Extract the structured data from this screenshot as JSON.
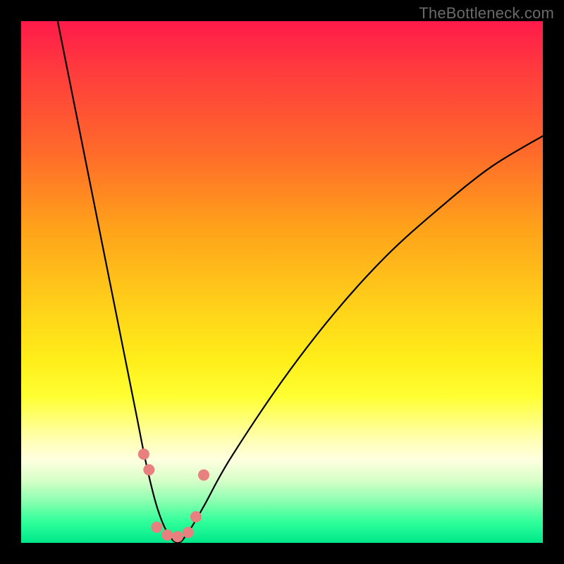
{
  "watermark": "TheBottleneck.com",
  "chart_data": {
    "type": "line",
    "title": "",
    "xlabel": "",
    "ylabel": "",
    "xlim": [
      0,
      100
    ],
    "ylim": [
      0,
      100
    ],
    "grid": false,
    "legend": false,
    "background_gradient": {
      "top": "#ff1a4a",
      "mid": "#ffee1a",
      "bottom": "#00e88a"
    },
    "series": [
      {
        "name": "bottleneck-curve",
        "type": "line",
        "x": [
          7,
          10,
          13,
          16,
          19,
          22,
          24,
          26,
          28,
          30,
          32,
          35,
          40,
          50,
          60,
          70,
          80,
          90,
          100
        ],
        "y": [
          100,
          85,
          70,
          55,
          40,
          25,
          15,
          7,
          2,
          0,
          2,
          7,
          16,
          31,
          44,
          55,
          64,
          72,
          78
        ]
      }
    ],
    "markers": {
      "name": "highlighted-points",
      "color": "#e98080",
      "x": [
        23.5,
        24.5,
        26,
        28,
        30,
        32,
        33.5,
        35
      ],
      "y": [
        17,
        14,
        3,
        1.5,
        1.2,
        2,
        5,
        13
      ]
    }
  }
}
